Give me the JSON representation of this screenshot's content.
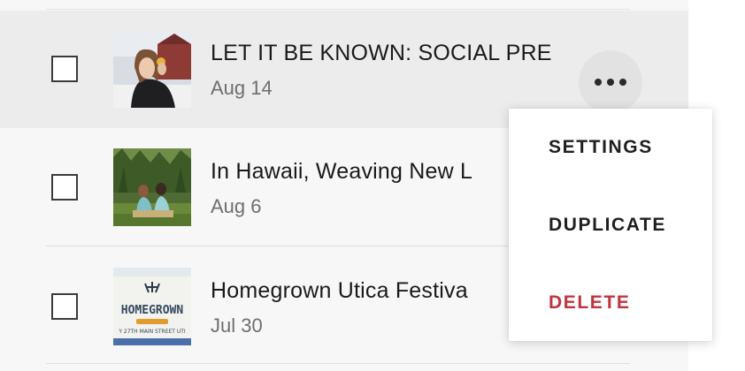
{
  "rows": [
    {
      "title": "LET IT BE KNOWN: SOCIAL PRE",
      "date": "Aug 14",
      "selected": true
    },
    {
      "title": "In Hawaii, Weaving New L",
      "date": "Aug 6",
      "selected": false
    },
    {
      "title": "Homegrown Utica Festiva",
      "date": "Jul 30",
      "selected": false
    }
  ],
  "thumbnails": {
    "row3_sign_text": "HOMEGROWN",
    "row3_sign_subtext": "Y 27TH  MAIN STREET UTI"
  },
  "more_button": {
    "icon": "more-horizontal-icon"
  },
  "menu": {
    "items": [
      {
        "label": "SETTINGS",
        "style": "normal"
      },
      {
        "label": "DUPLICATE",
        "style": "normal"
      },
      {
        "label": "DELETE",
        "style": "danger"
      }
    ]
  },
  "colors": {
    "danger": "#c0343d",
    "selected_row": "#ececec",
    "list_background": "#f7f7f7"
  }
}
